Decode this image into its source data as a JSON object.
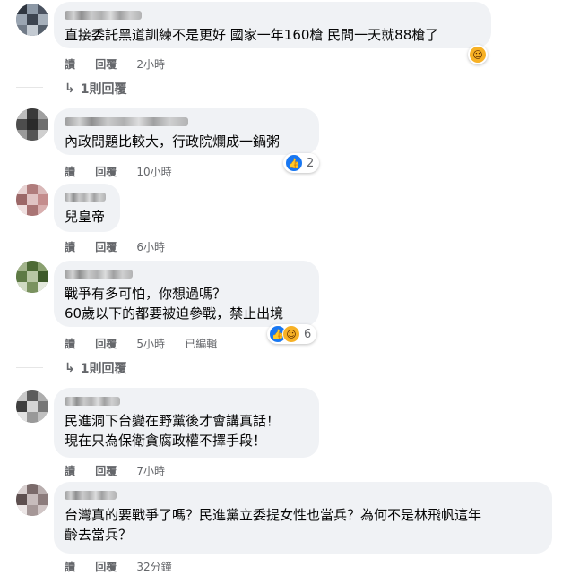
{
  "labels": {
    "reply": "讀",
    "respond": "回覆",
    "edited": "已編輯"
  },
  "comments": [
    {
      "text_lines": [
        "直接委託黑道訓練不是更好 國家一年160槍 民間一天就88槍了"
      ],
      "time": "2小時",
      "reactions": {
        "icons": [
          "haha-icon"
        ],
        "count": ""
      },
      "replies": "1則回覆"
    },
    {
      "text_lines": [
        "內政問題比較大，行政院爛成一鍋粥"
      ],
      "time": "10小時",
      "reactions": {
        "icons": [
          "like-icon"
        ],
        "count": "2"
      }
    },
    {
      "text_lines": [
        "兒皇帝"
      ],
      "time": "6小時"
    },
    {
      "text_lines": [
        "戰爭有多可怕，你想過嗎？",
        "60歲以下的都要被迫參戰，禁止出境"
      ],
      "time": "5小時",
      "edited": true,
      "reactions": {
        "icons": [
          "like-icon",
          "haha-icon"
        ],
        "count": "6"
      },
      "replies": "1則回覆"
    },
    {
      "text_lines": [
        "民進洞下台變在野黨後才會講真話！",
        "現在只為保衛貪腐政權不擇手段！"
      ],
      "time": "7小時"
    },
    {
      "text_lines": [
        "台灣真的要戰爭了嗎？民進黨立委提女性也當兵？為何不是林飛帆這年",
        "齡去當兵？"
      ],
      "time": "32分鐘"
    }
  ]
}
